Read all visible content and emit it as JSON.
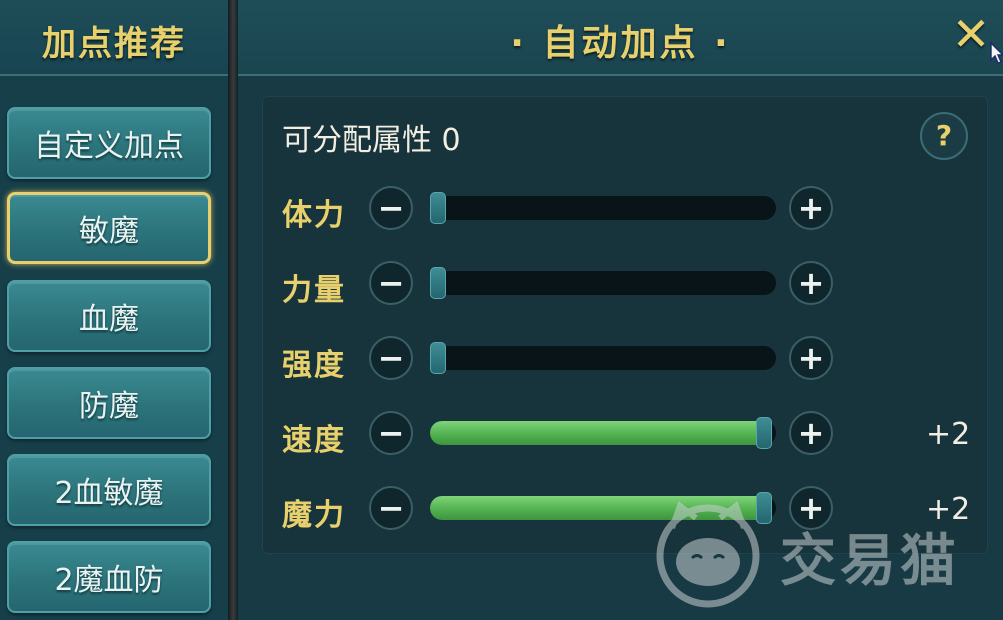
{
  "left_panel": {
    "title": "加点推荐",
    "presets": [
      {
        "label": "自定义加点",
        "selected": false
      },
      {
        "label": "敏魔",
        "selected": true
      },
      {
        "label": "血魔",
        "selected": false
      },
      {
        "label": "防魔",
        "selected": false
      },
      {
        "label": "2血敏魔",
        "selected": false
      },
      {
        "label": "2魔血防",
        "selected": false
      }
    ]
  },
  "right_panel": {
    "title": "· 自动加点 ·",
    "close_label": "✕",
    "points_label": "可分配属性 0",
    "help_label": "?",
    "minus_label": "−",
    "plus_label": "+",
    "stats": [
      {
        "name": "体力",
        "fill": 0.0,
        "bonus": ""
      },
      {
        "name": "力量",
        "fill": 0.0,
        "bonus": ""
      },
      {
        "name": "强度",
        "fill": 0.0,
        "bonus": ""
      },
      {
        "name": "速度",
        "fill": 1.0,
        "bonus": "+2"
      },
      {
        "name": "魔力",
        "fill": 1.0,
        "bonus": "+2"
      }
    ]
  },
  "watermark": {
    "text": "交易猫"
  },
  "colors": {
    "accent_gold": "#e8d06c",
    "fill_green": "#4faf4e",
    "panel_bg": "#183a44"
  }
}
